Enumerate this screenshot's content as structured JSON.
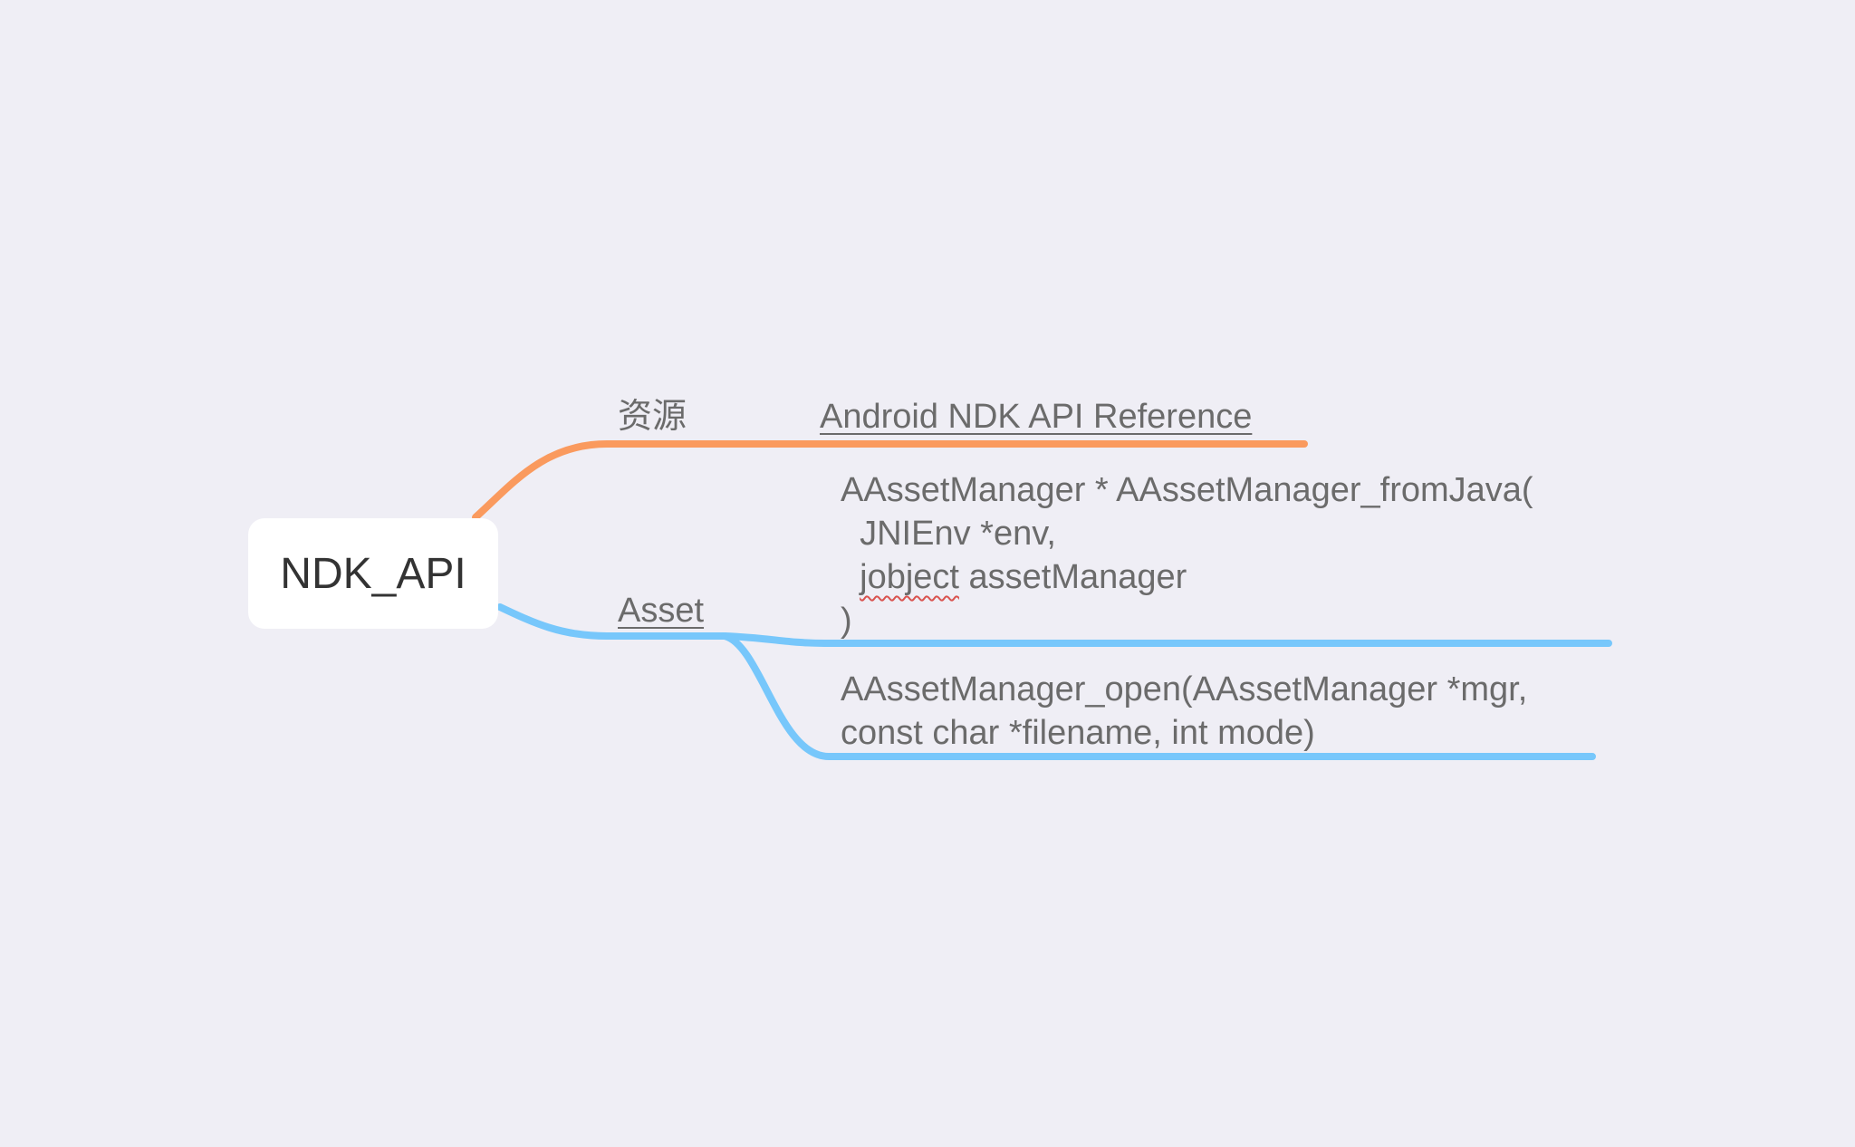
{
  "mindmap": {
    "root": {
      "label": "NDK_API"
    },
    "colors": {
      "background": "#efeef5",
      "branch_resources": "#fa9a5e",
      "branch_asset": "#77c7fb",
      "text": "#6b6b6b",
      "root_text": "#333333"
    },
    "branches": [
      {
        "label": "资源",
        "children": [
          {
            "label": "Android NDK API Reference"
          }
        ]
      },
      {
        "label": "Asset",
        "children": [
          {
            "lines": [
              "AAssetManager * AAssetManager_fromJava(",
              "  JNIEnv *env,",
              "  jobject assetManager",
              ")"
            ],
            "misspelled_word": "jobject"
          },
          {
            "lines": [
              "AAssetManager_open(AAssetManager *mgr,",
              "const char *filename, int mode)"
            ]
          }
        ]
      }
    ]
  }
}
